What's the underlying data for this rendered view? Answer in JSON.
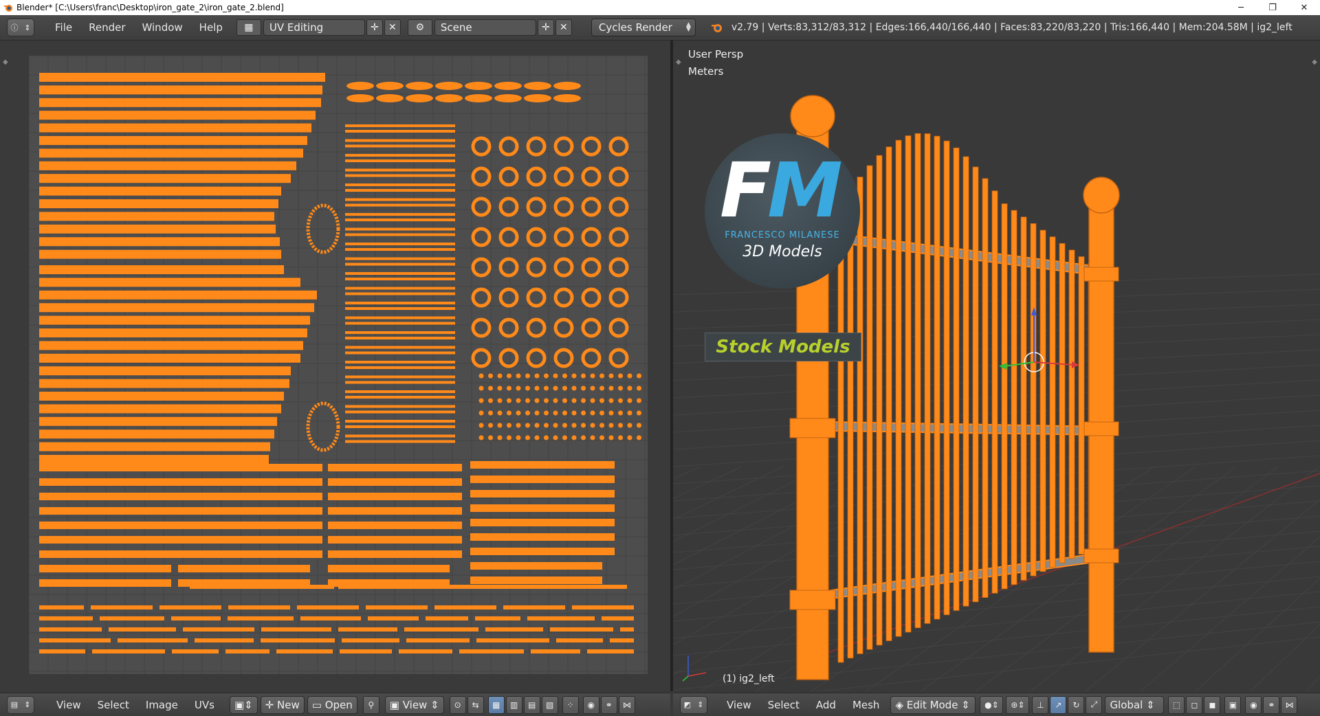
{
  "window": {
    "title": "Blender* [C:\\Users\\franc\\Desktop\\iron_gate_2\\iron_gate_2.blend]",
    "minimize": "─",
    "restore": "❐",
    "close": "✕"
  },
  "info_header": {
    "menus": [
      "File",
      "Render",
      "Window",
      "Help"
    ],
    "screen_layout": "UV Editing",
    "scene": "Scene",
    "render_engine": "Cycles Render",
    "stats": "v2.79 | Verts:83,312/83,312 | Edges:166,440/166,440 | Faces:83,220/83,220 | Tris:166,440 | Mem:204.58M | ig2_left"
  },
  "viewport": {
    "view_name": "User Persp",
    "units": "Meters",
    "object_label": "(1) ig2_left"
  },
  "logo": {
    "letters_f": "F",
    "letters_m": "M",
    "brand": "FRANCESCO MILANESE",
    "subtitle": "3D Models",
    "badge": "Stock Models"
  },
  "uv_footer": {
    "menus": [
      "View",
      "Select",
      "Image",
      "UVs"
    ],
    "new_label": "New",
    "open_label": "Open",
    "view_label": "View"
  },
  "viewport_footer": {
    "menus": [
      "View",
      "Select",
      "Add",
      "Mesh"
    ],
    "mode": "Edit Mode",
    "orientation": "Global"
  },
  "colors": {
    "uv_orange": "#ff8a1a",
    "panel": "#393939",
    "grid_bg": "#4d4d4d"
  }
}
